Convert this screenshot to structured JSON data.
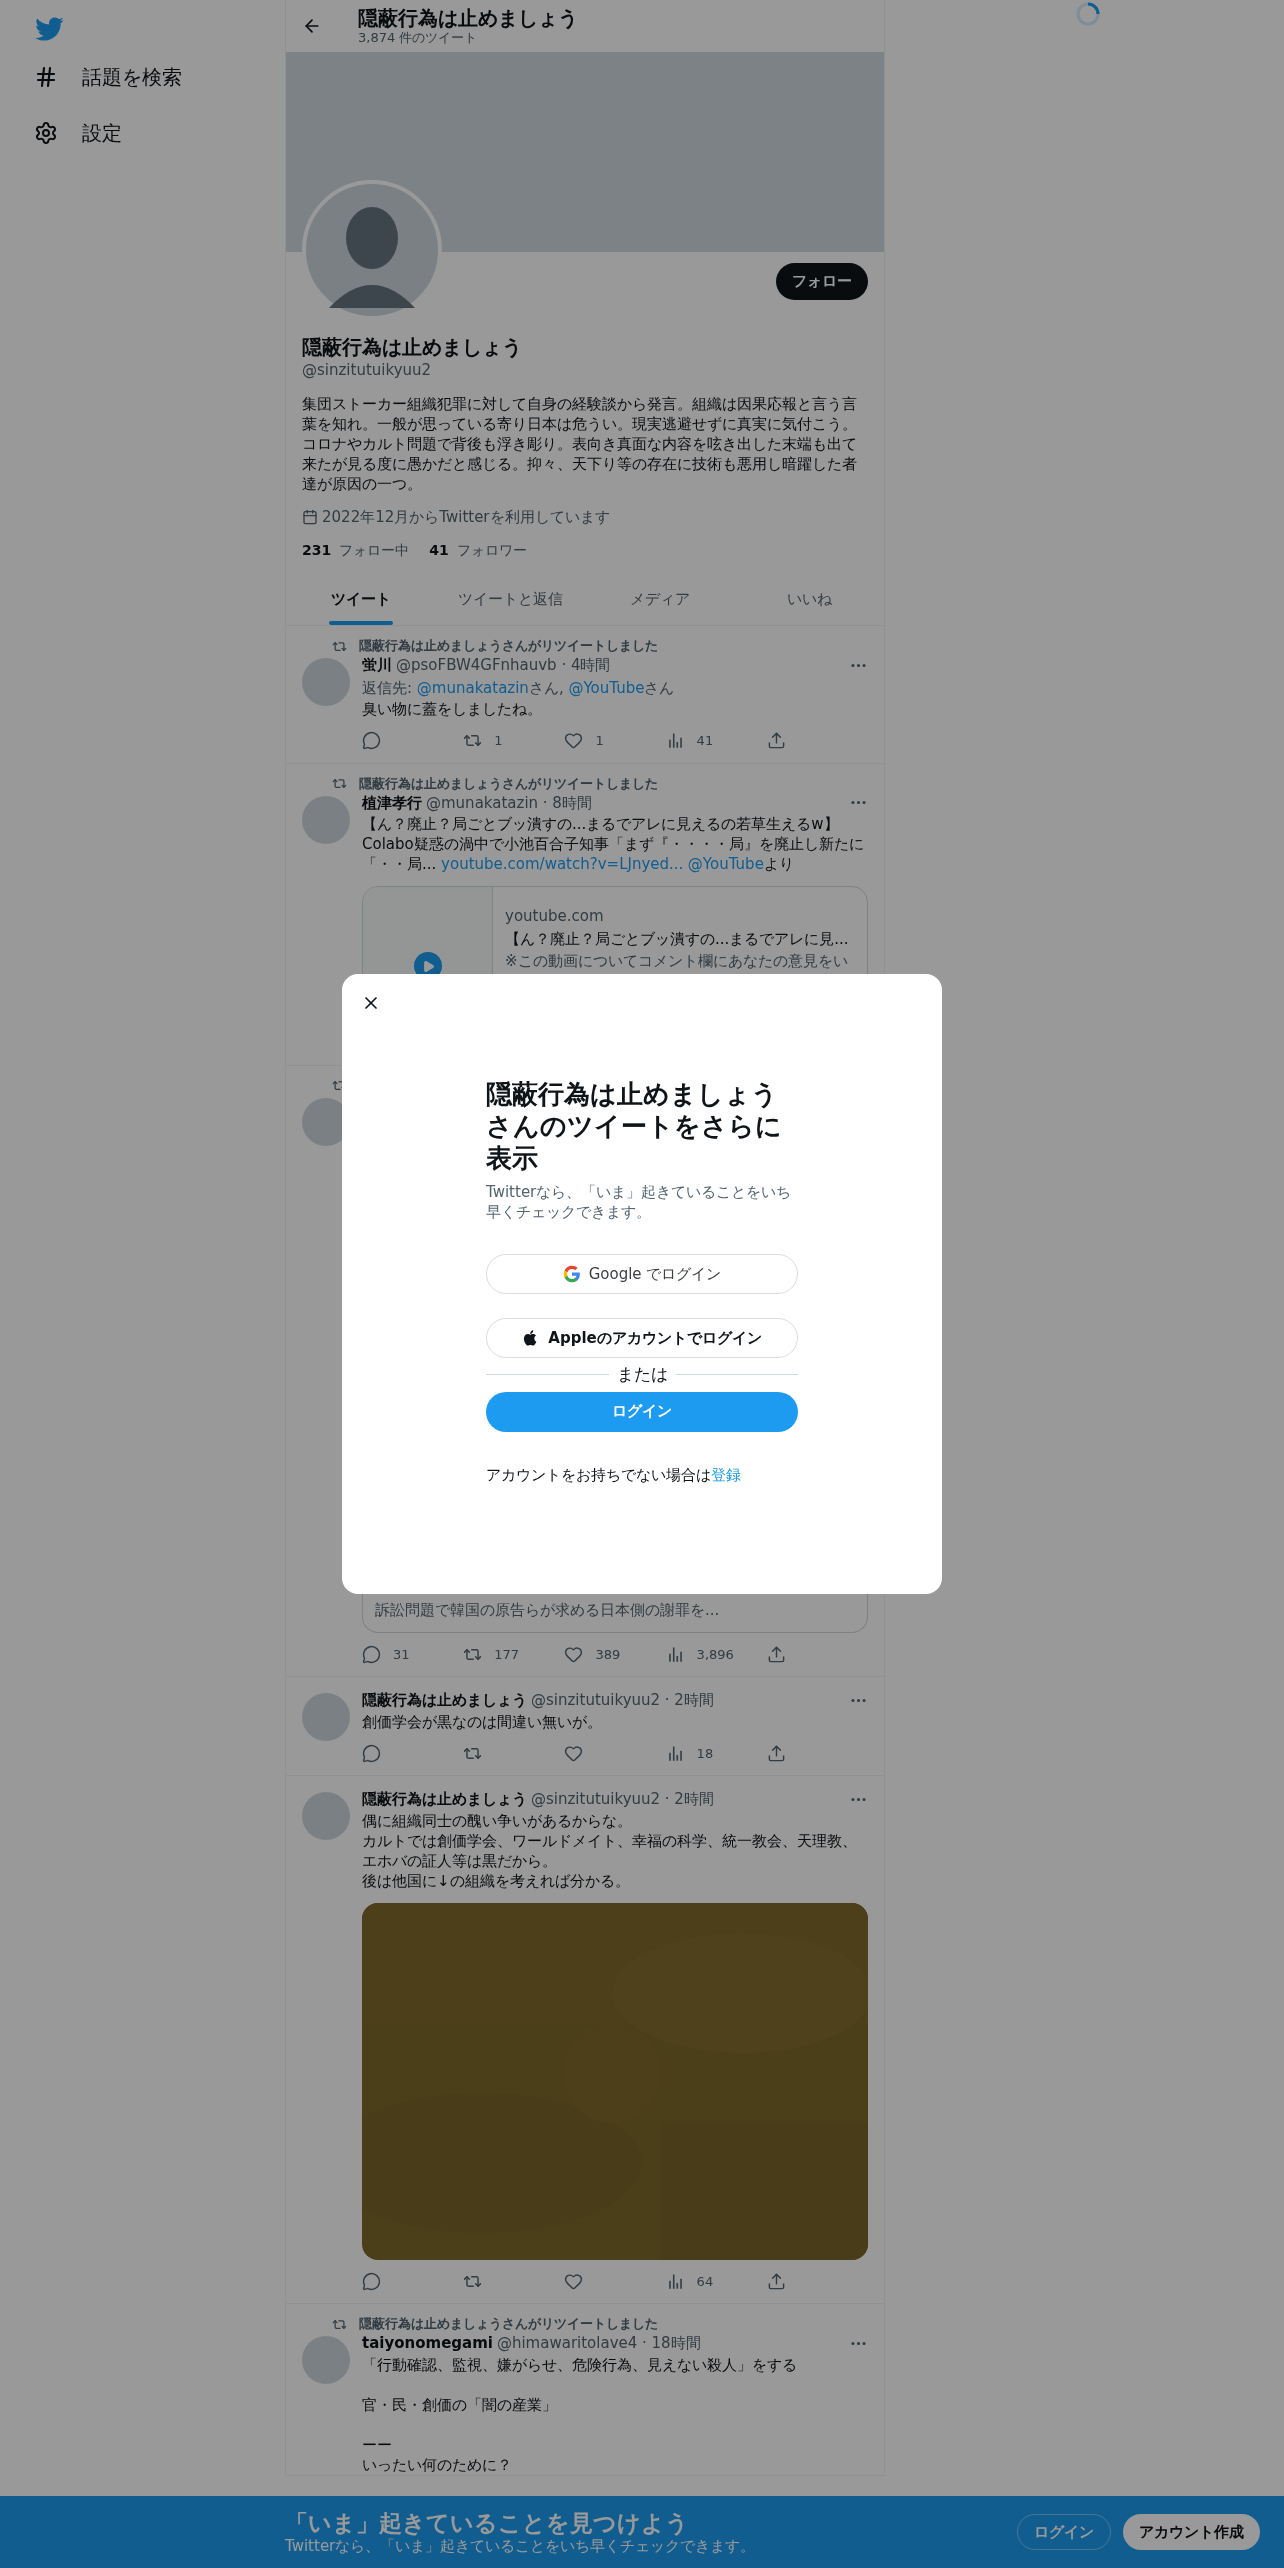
{
  "sidebar": {
    "items": [
      {
        "kind": "explore",
        "label": "話題を検索"
      },
      {
        "kind": "settings",
        "label": "設定"
      }
    ]
  },
  "header": {
    "title": "隠蔽行為は止めましょう",
    "subtitle": "3,874 件のツイート"
  },
  "profile": {
    "follow_button": "フォロー",
    "name": "隠蔽行為は止めましょう",
    "handle": "@sinzitutuikyuu2",
    "bio": "集団ストーカー組織犯罪に対して自身の経験談から発言。組織は因果応報と言う言葉を知れ。一般が思っている寄り日本は危うい。現実逃避せずに真実に気付こう。コロナやカルト問題で背後も浮き彫り。表向き真面な内容を呟き出した末端も出て来たが見る度に愚かだと感じる。抑々、天下り等の存在に技術も悪用し暗躍した者達が原因の一つ。",
    "joined": "2022年12月からTwitterを利用しています",
    "following": {
      "count": "231",
      "label": "フォロー中"
    },
    "followers": {
      "count": "41",
      "label": "フォロワー"
    }
  },
  "tabs": [
    {
      "label": "ツイート",
      "selected": true
    },
    {
      "label": "ツイートと返信",
      "selected": false
    },
    {
      "label": "メディア",
      "selected": false
    },
    {
      "label": "いいね",
      "selected": false
    }
  ],
  "tweets": [
    {
      "retweet": true,
      "retweeted_by": "隠蔽行為は止めましょうさんがリツイートしました",
      "name": "蛍川",
      "meta": "@psoFBW4GFnhauvb · 4時間",
      "reply_to": [
        {
          "kind": "text",
          "text": "返信先: "
        },
        {
          "kind": "link",
          "text": "@munakatazin"
        },
        {
          "kind": "text",
          "text": "さん, "
        },
        {
          "kind": "link",
          "text": "@YouTube"
        },
        {
          "kind": "text",
          "text": "さん"
        }
      ],
      "text": [
        {
          "kind": "text",
          "text": "臭い物に蓋をしましたね。"
        }
      ],
      "actions": [
        {
          "kind": "reply"
        },
        {
          "kind": "retweet",
          "count": "1"
        },
        {
          "kind": "like",
          "count": "1"
        },
        {
          "kind": "views",
          "count": "41"
        },
        {
          "kind": "share"
        }
      ]
    },
    {
      "retweet": true,
      "retweeted_by": "隠蔽行為は止めましょうさんがリツイートしました",
      "name": "植津孝行",
      "meta": "@munakatazin · 8時間",
      "text": [
        {
          "kind": "text",
          "text": "【ん？廃止？局ごとブッ潰すの...まるでアレに見えるの若草生えるw】Colabo疑惑の渦中で小池百合子知事「まず『・・・・局』を廃止し新たに「・・局... "
        },
        {
          "kind": "link",
          "text": "youtube.com/watch?v=LJnyed..."
        },
        {
          "kind": "link",
          "text": "@YouTube"
        },
        {
          "kind": "text",
          "text": "より"
        }
      ],
      "card": {
        "domain": "youtube.com",
        "title": "【ん？廃止？局ごとブッ潰すの...まるでアレに見...",
        "description": "※この動画についてコメント欄にあなたの意見をい"
      }
    },
    {
      "retweet": true,
      "card_snippet": "訴訟問題で韓国の原告らが求める日本側の謝罪を...",
      "actions": [
        {
          "kind": "reply",
          "count": "31"
        },
        {
          "kind": "retweet",
          "count": "177"
        },
        {
          "kind": "like",
          "count": "389"
        },
        {
          "kind": "views",
          "count": "3,896"
        },
        {
          "kind": "share"
        }
      ]
    },
    {
      "retweet": false,
      "name": "隠蔽行為は止めましょう",
      "meta": "@sinzitutuikyuu2 · 2時間",
      "text": [
        {
          "kind": "text",
          "text": "創価学会が黒なのは間違い無いが。"
        }
      ],
      "actions": [
        {
          "kind": "reply"
        },
        {
          "kind": "retweet"
        },
        {
          "kind": "like"
        },
        {
          "kind": "views",
          "count": "18"
        },
        {
          "kind": "share"
        }
      ]
    },
    {
      "retweet": false,
      "name": "隠蔽行為は止めましょう",
      "meta": "@sinzitutuikyuu2 · 2時間",
      "paragraphs": [
        [
          "偶に組織同士の醜い争いがあるからな。",
          "カルトでは創価学会、ワールドメイト、幸福の科学、統一教会、天理教、エホバの証人等は黒だから。",
          "後は他国に↓の組織を考えれば分かる。"
        ]
      ],
      "media": {
        "kind": "picture"
      },
      "actions": [
        {
          "kind": "reply"
        },
        {
          "kind": "retweet"
        },
        {
          "kind": "like"
        },
        {
          "kind": "views",
          "count": "64"
        },
        {
          "kind": "share"
        }
      ]
    },
    {
      "retweet": true,
      "retweeted_by": "隠蔽行為は止めましょうさんがリツイートしました",
      "name": "taiyonomegami",
      "meta": "@himawaritolave4 · 18時間",
      "paragraphs": [
        [
          "「行動確認、監視、嫌がらせ、危険行為、見えない殺人」をする"
        ],
        [
          "官・民・創価の「闇の産業」"
        ],
        [
          "ーー",
          "いったい何のために？"
        ]
      ]
    }
  ],
  "modal": {
    "title": "隠蔽行為は止めましょうさんのツイートをさらに表示",
    "subtitle": "Twitterなら、「いま」起きていることをいち早くチェックできます。",
    "buttons": [
      {
        "kind": "google",
        "label": "Google でログイン"
      },
      {
        "kind": "apple",
        "label": "Appleのアカウントでログイン"
      }
    ],
    "divider": "または",
    "login": "ログイン",
    "footer": "アカウントをお持ちでない場合は",
    "signup_link": "登録"
  },
  "bottom_bar": {
    "title": "「いま」起きていることを見つけよう",
    "subtitle": "Twitterなら、「いま」起きていることをいち早くチェックできます。",
    "login": "ログイン",
    "signup": "アカウント作成"
  }
}
